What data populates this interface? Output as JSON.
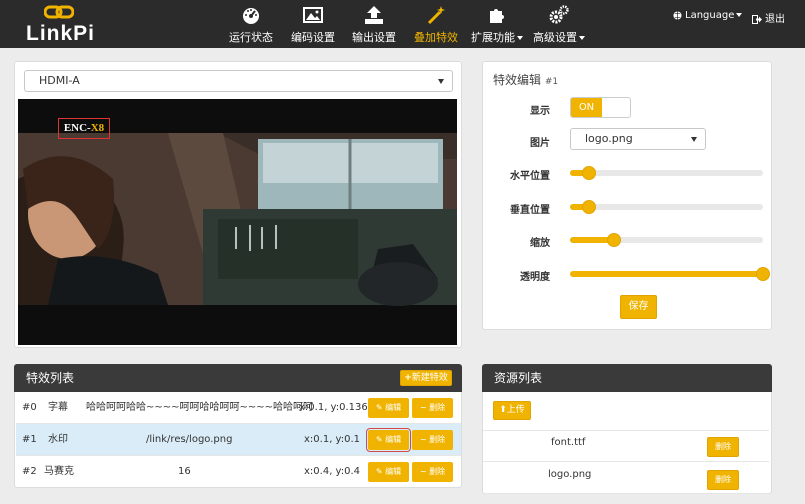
{
  "brand": {
    "name": "LinkPi"
  },
  "nav": {
    "items": [
      {
        "label": "运行状态",
        "icon": "dashboard-icon"
      },
      {
        "label": "编码设置",
        "icon": "image-icon"
      },
      {
        "label": "输出设置",
        "icon": "upload-icon"
      },
      {
        "label": "叠加特效",
        "icon": "magic-wand-icon"
      },
      {
        "label": "扩展功能",
        "icon": "puzzle-icon"
      },
      {
        "label": "高级设置",
        "icon": "gears-icon"
      }
    ],
    "language": "Language",
    "logout": "退出"
  },
  "preview": {
    "source": "HDMI-A",
    "overlay_text_enc": "ENC-",
    "overlay_text_x8": "X8"
  },
  "editor": {
    "title": "特效编辑",
    "title_id": "#1",
    "show_label": "显示",
    "show_state": "ON",
    "image_label": "图片",
    "image_value": "logo.png",
    "h_label": "水平位置",
    "v_label": "垂直位置",
    "scale_label": "缩放",
    "alpha_label": "透明度",
    "h_value": 0.1,
    "v_value": 0.1,
    "scale_value": 0.23,
    "alpha_value": 1.0,
    "save": "保存"
  },
  "effects": {
    "title": "特效列表",
    "new_button": "新建特效",
    "edit_label": "编辑",
    "delete_label": "删除",
    "rows": [
      {
        "id": "#0",
        "type": "字幕",
        "content": "哈哈呵呵哈哈~~~~呵呵哈哈呵呵~~~~哈哈呵呵",
        "pos": "x:0.1, y:0.136"
      },
      {
        "id": "#1",
        "type": "水印",
        "content": "/link/res/logo.png",
        "pos": "x:0.1, y:0.1"
      },
      {
        "id": "#2",
        "type": "马赛克",
        "content": "16",
        "pos": "x:0.4, y:0.4"
      }
    ]
  },
  "resources": {
    "title": "资源列表",
    "upload": "上传",
    "delete_label": "删除",
    "files": [
      "font.ttf",
      "logo.png"
    ]
  },
  "colors": {
    "accent": "#f0b400",
    "nav_bg": "#2b2b2b",
    "panel_header": "#3a3a3a",
    "selected_row": "#d9ecf7"
  }
}
